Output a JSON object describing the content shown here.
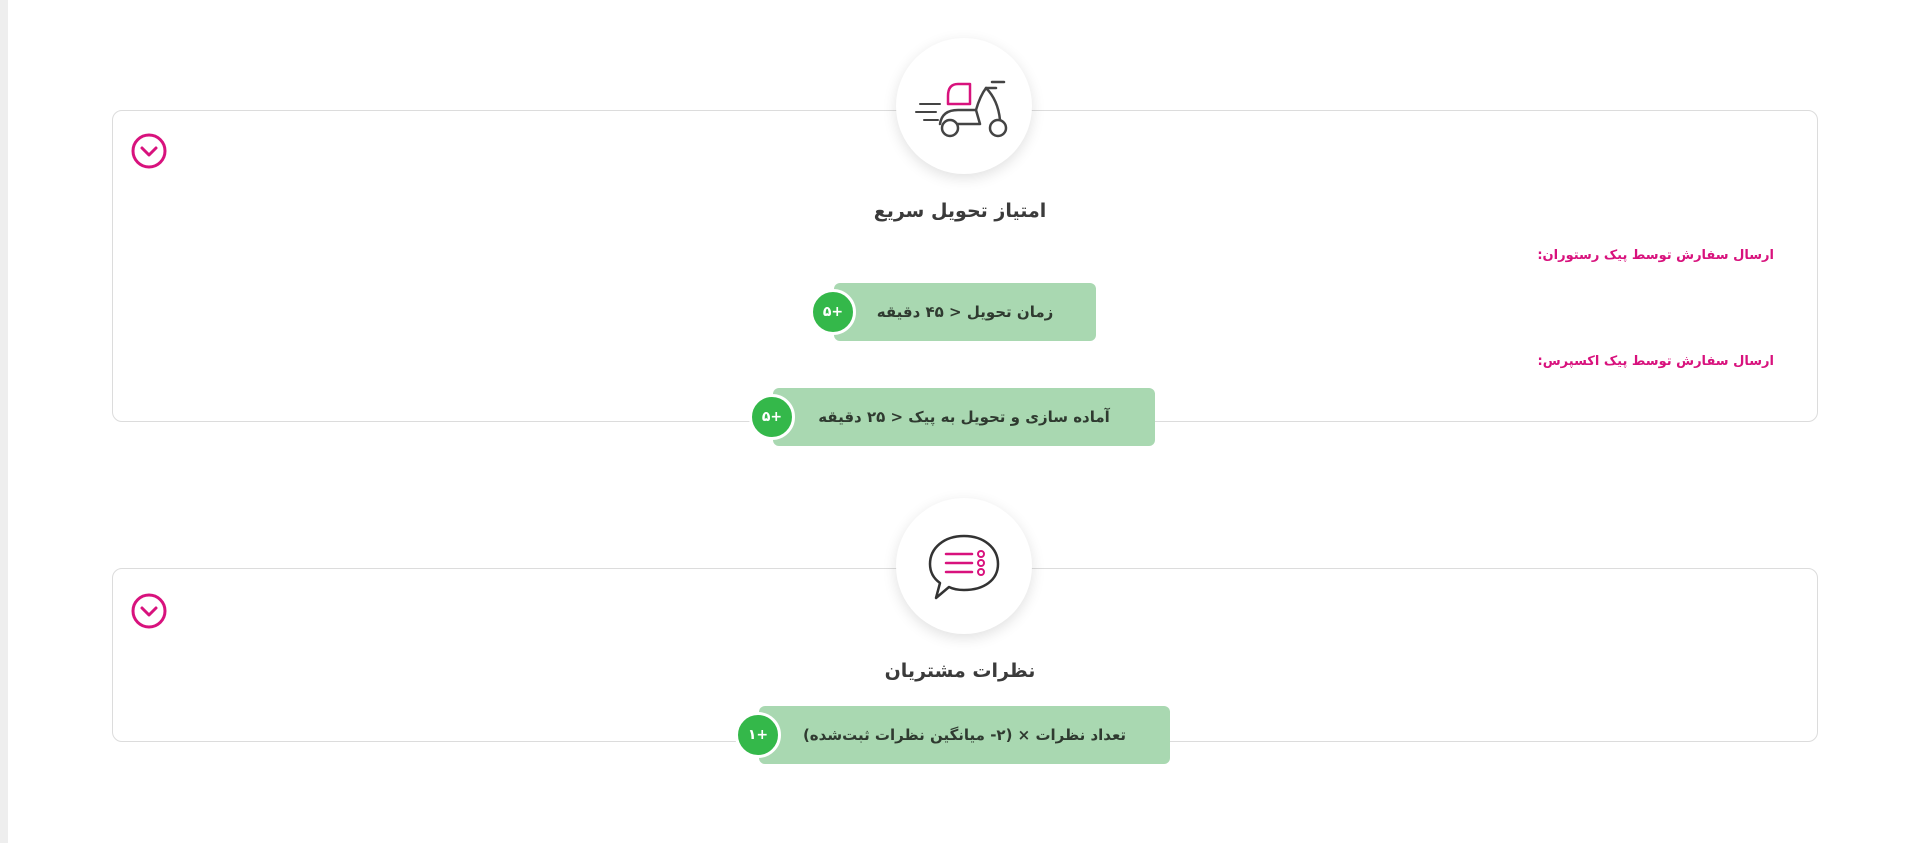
{
  "fast_delivery": {
    "title": "امتیاز تحویل سریع",
    "icon": "delivery-scooter-icon",
    "expand_icon": "chevron-down-circle-icon",
    "restaurant_courier_label": "ارسال سفارش توسط پیک رستوران:",
    "restaurant_rule": "زمان تحویل < ۴۵ دقیقه",
    "restaurant_points": "+۵",
    "express_courier_label": "ارسال سفارش توسط پیک اکسپرس:",
    "express_rule": "آماده سازی و تحویل به پیک < ۲۵ دقیقه",
    "express_points": "+۵"
  },
  "customer_reviews": {
    "title": "نظرات مشتریان",
    "icon": "chat-list-icon",
    "expand_icon": "chevron-down-circle-icon",
    "rule": "تعداد نظرات × (۲- میانگین نظرات ثبت‌شده)",
    "points": "+۱"
  },
  "colors": {
    "accent_pink": "#d8127d",
    "pill_green": "#a9d8b1",
    "points_green": "#34b84a",
    "border": "#dcdcdc"
  }
}
